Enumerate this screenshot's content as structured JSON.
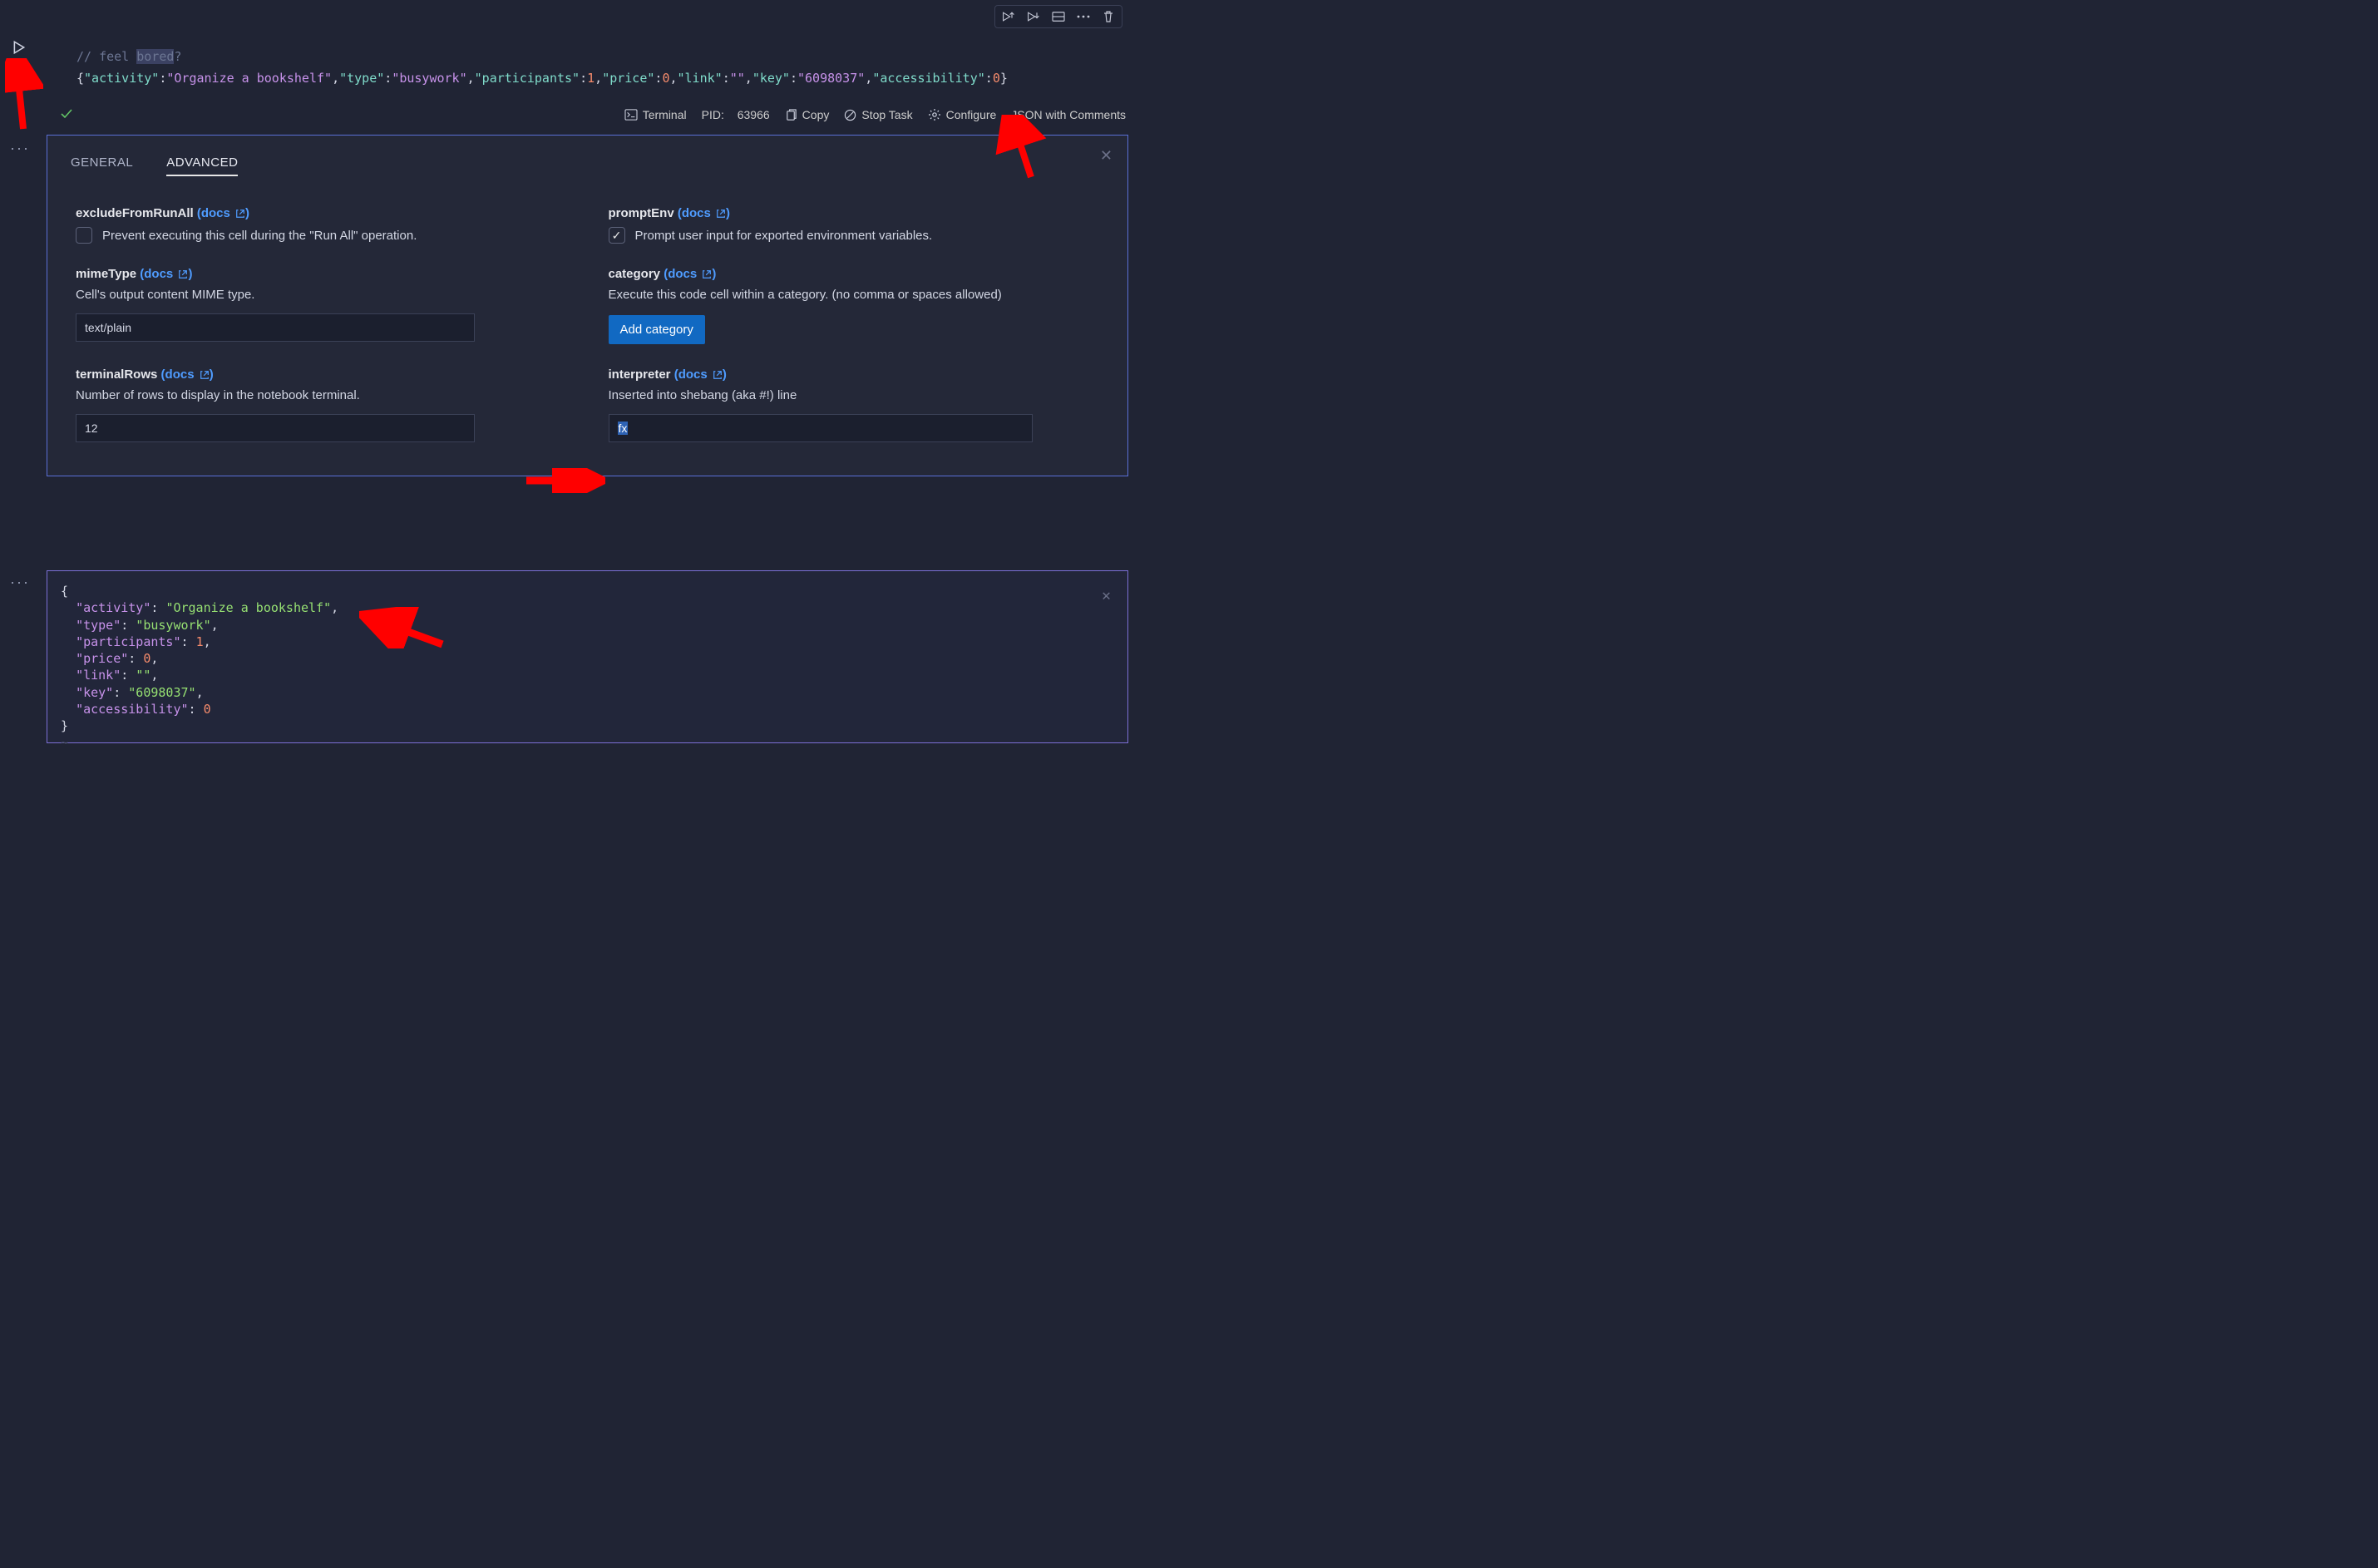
{
  "toolbar": {
    "runAbove": "Execute Cell and Above",
    "runBelow": "Execute Cell and Below",
    "split": "Split Cell",
    "more": "More Actions",
    "delete": "Delete Cell"
  },
  "cell": {
    "comment_prefix": "// feel ",
    "comment_sel": "bored",
    "comment_suffix": "?",
    "json_line": {
      "activity": "Organize a bookshelf",
      "type": "busywork",
      "participants": 1,
      "price": 0,
      "link": "",
      "key": "6098037",
      "accessibility": 0
    }
  },
  "status": {
    "terminal": "Terminal",
    "pid_label": "PID:",
    "pid_value": "63966",
    "copy": "Copy",
    "stop": "Stop Task",
    "configure": "Configure",
    "lang": "JSON with Comments"
  },
  "panel": {
    "tabs": {
      "general": "GENERAL",
      "advanced": "ADVANCED"
    },
    "docs": "docs",
    "fields": {
      "excludeFromRunAll": {
        "label": "excludeFromRunAll",
        "desc": "Prevent executing this cell during the \"Run All\" operation.",
        "checked": false
      },
      "promptEnv": {
        "label": "promptEnv",
        "desc": "Prompt user input for exported environment variables.",
        "checked": true
      },
      "mimeType": {
        "label": "mimeType",
        "desc": "Cell's output content MIME type.",
        "value": "text/plain"
      },
      "category": {
        "label": "category",
        "desc": "Execute this code cell within a category. (no comma or spaces allowed)",
        "button": "Add category"
      },
      "terminalRows": {
        "label": "terminalRows",
        "desc": "Number of rows to display in the notebook terminal.",
        "value": "12"
      },
      "interpreter": {
        "label": "interpreter",
        "desc": "Inserted into shebang (aka #!) line",
        "value": "fx"
      }
    }
  },
  "output": {
    "activity": "Organize a bookshelf",
    "type": "busywork",
    "participants": 1,
    "price": 0,
    "link": "",
    "key": "6098037",
    "accessibility": 0
  }
}
